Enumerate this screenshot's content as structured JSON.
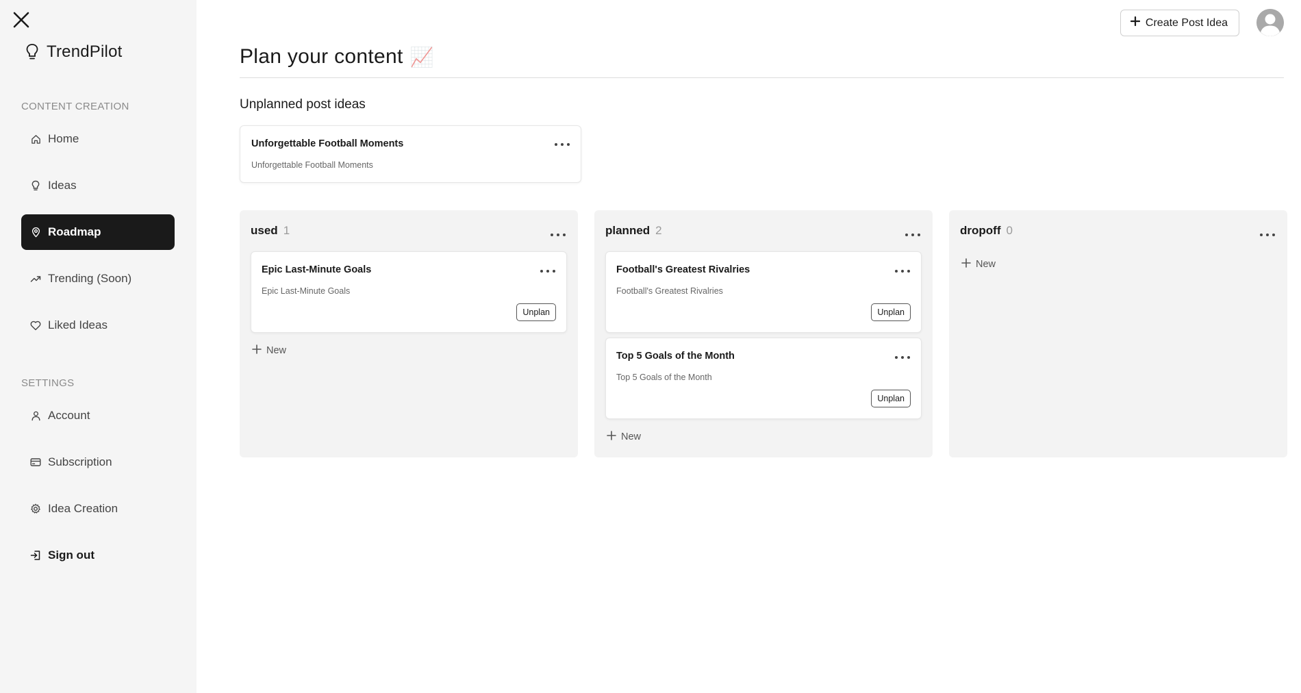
{
  "app": {
    "brand": "TrendPilot"
  },
  "sidebar": {
    "section_content": "CONTENT CREATION",
    "section_settings": "SETTINGS",
    "items": [
      {
        "label": "Home",
        "icon": "home-icon"
      },
      {
        "label": "Ideas",
        "icon": "lightbulb-icon"
      },
      {
        "label": "Roadmap",
        "icon": "map-pin-icon",
        "active": true
      },
      {
        "label": "Trending (Soon)",
        "icon": "trending-up-icon"
      },
      {
        "label": "Liked Ideas",
        "icon": "heart-icon"
      }
    ],
    "settings_items": [
      {
        "label": "Account",
        "icon": "user-icon"
      },
      {
        "label": "Subscription",
        "icon": "credit-card-icon"
      },
      {
        "label": "Idea Creation",
        "icon": "gear-icon"
      }
    ],
    "signout": "Sign out"
  },
  "header": {
    "create_button": "Create Post Idea",
    "title": "Plan your content",
    "title_emoji": "📈"
  },
  "unplanned": {
    "heading": "Unplanned post ideas",
    "cards": [
      {
        "title": "Unforgettable Football Moments",
        "subtitle": "Unforgettable Football Moments"
      }
    ]
  },
  "columns": [
    {
      "name": "used",
      "count": "1",
      "cards": [
        {
          "title": "Epic Last-Minute Goals",
          "subtitle": "Epic Last-Minute Goals",
          "action": "Unplan"
        }
      ],
      "new_label": "New"
    },
    {
      "name": "planned",
      "count": "2",
      "cards": [
        {
          "title": "Football's Greatest Rivalries",
          "subtitle": "Football's Greatest Rivalries",
          "action": "Unplan"
        },
        {
          "title": "Top 5 Goals of the Month",
          "subtitle": "Top 5 Goals of the Month",
          "action": "Unplan"
        }
      ],
      "new_label": "New"
    },
    {
      "name": "dropoff",
      "count": "0",
      "cards": [],
      "new_label": "New"
    }
  ],
  "colors": {
    "sidebar_bg": "#f5f5f5",
    "active_bg": "#1a1a1a",
    "column_bg": "#f3f3f3",
    "avatar": "#a9a9a9"
  }
}
